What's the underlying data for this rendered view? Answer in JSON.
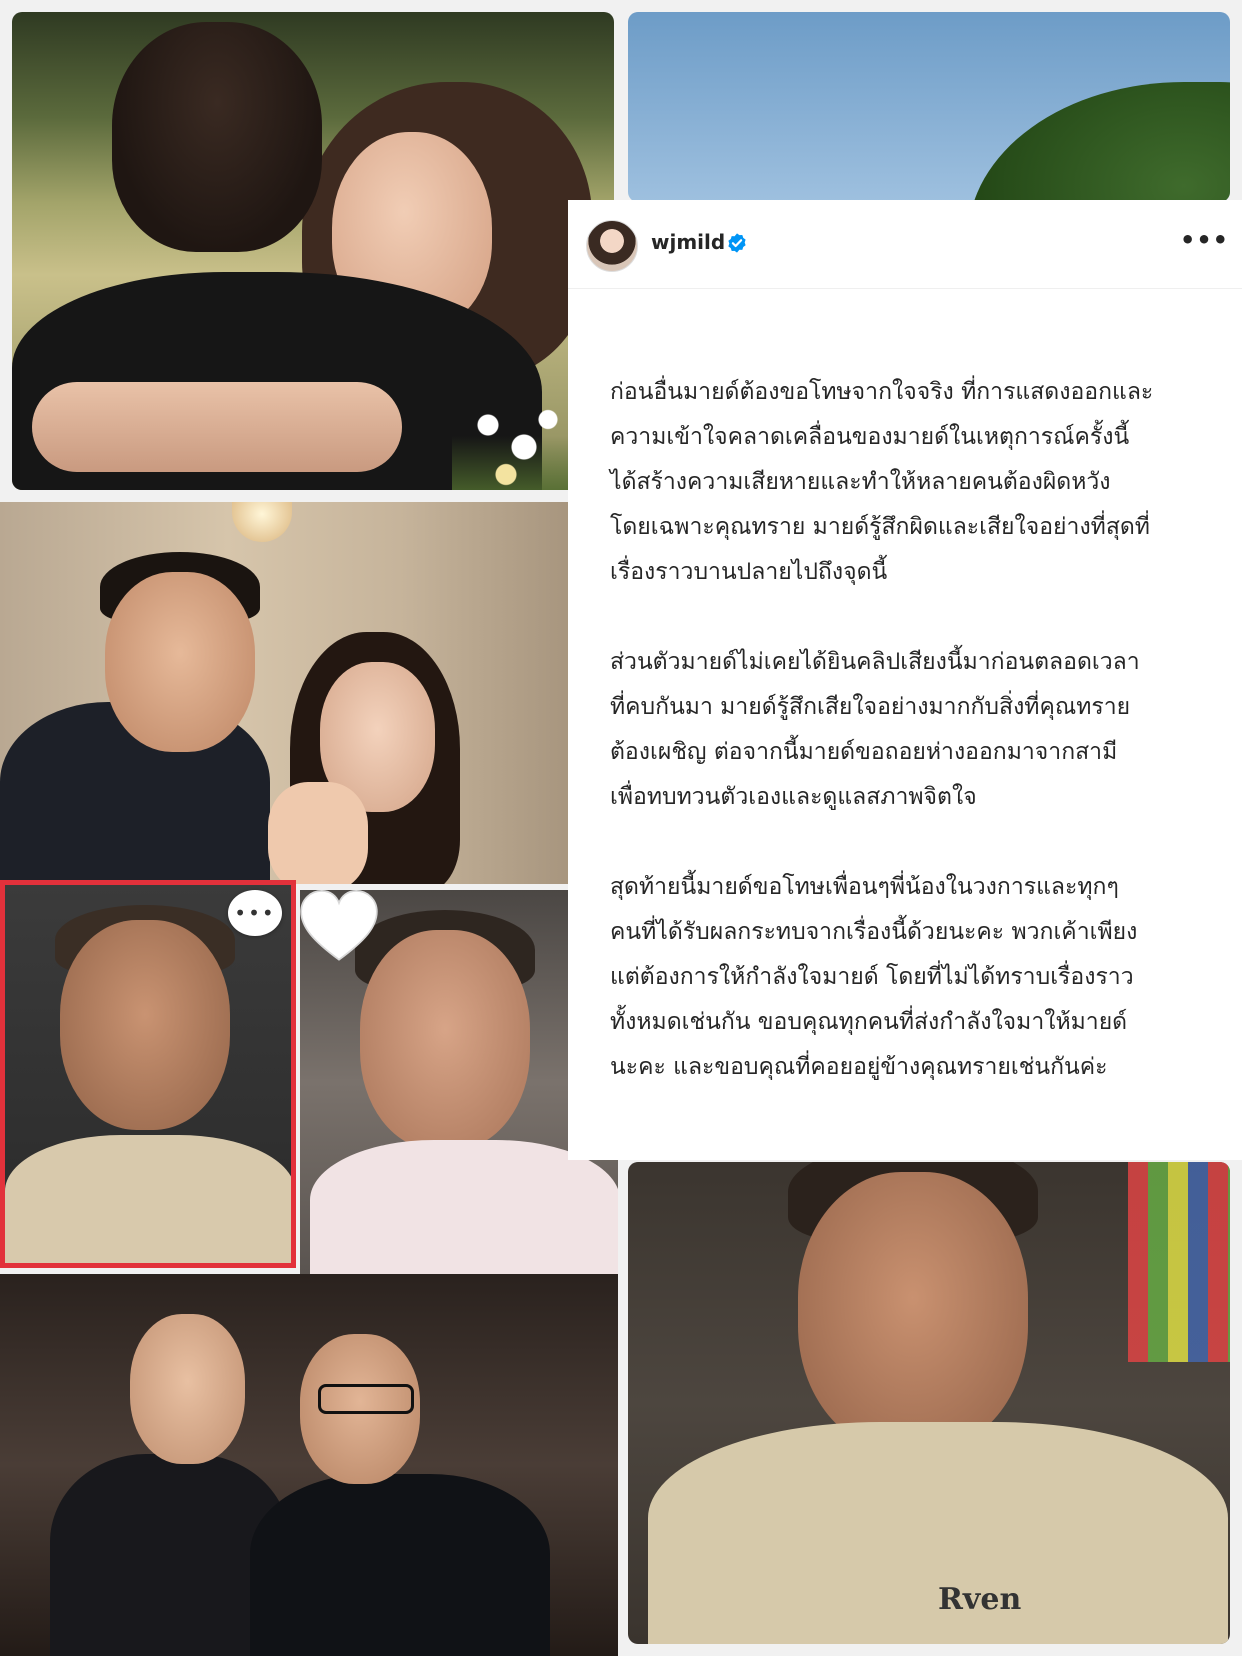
{
  "post": {
    "username": "wjmild",
    "verified": true,
    "more_label": "•••",
    "icons": {
      "avatar": "profile-avatar",
      "verified": "verified-badge-icon",
      "more": "more-options-icon"
    },
    "caption": [
      "ก่อนอื่นมายด์ต้องขอโทษจากใจจริง ที่การแสดงออกและ\nความเข้าใจคลาดเคลื่อนของมายด์ในเหตุการณ์ครั้งนี้\nได้สร้างความเสียหายและทำให้หลายคนต้องผิดหวัง\nโดยเฉพาะคุณทราย มายด์รู้สึกผิดและเสียใจอย่างที่สุดที่\nเรื่องราวบานปลายไปถึงจุดนี้",
      "ส่วนตัวมายด์ไม่เคยได้ยินคลิปเสียงนี้มาก่อนตลอดเวลา\nที่คบกันมา มายด์รู้สึกเสียใจอย่างมากกับสิ่งที่คุณทราย\nต้องเผชิญ ต่อจากนี้มายด์ขอถอยห่างออกมาจากสามี\nเพื่อทบทวนตัวเองและดูแลสภาพจิตใจ",
      "สุดท้ายนี้มายด์ขอโทษเพื่อนๆพี่น้องในวงการและทุกๆ\nคนที่ได้รับผลกระทบจากเรื่องนี้ด้วยนะคะ พวกเค้าเพียง\nแต่ต้องการให้กำลังใจมายด์ โดยที่ไม่ได้ทราบเรื่องราว\nทั้งหมดเช่นกัน ขอบคุณทุกคนที่ส่งกำลังใจมาให้มายด์\nนะคะ และขอบคุณที่คอยอยู่ข้างคุณทรายเช่นกันค่ะ"
    ]
  },
  "collage": {
    "overlay_icons": [
      "speech-bubble-icon",
      "white-heart-icon"
    ],
    "logo_text": "Rven",
    "colors": {
      "highlight_border": "#e2313b",
      "verified_blue": "#0095f6"
    }
  }
}
